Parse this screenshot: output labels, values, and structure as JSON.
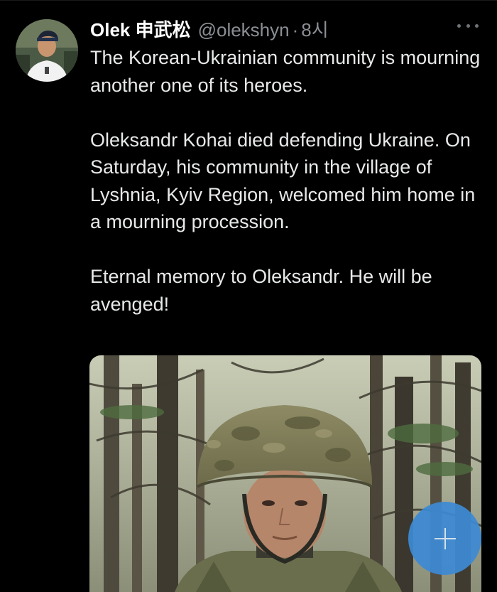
{
  "tweet": {
    "author": {
      "display_name": "Olek 申武松",
      "handle": "@olekshyn",
      "separator": "·",
      "time": "8시",
      "avatar_icon": "profile-photo"
    },
    "more_icon": "more-horizontal-icon",
    "paragraphs": [
      "The Korean-Ukrainian community is mourning another one of its heroes.",
      "Oleksandr Kohai died defending Ukraine. On Saturday, his community in the village of Lyshnia, Kyiv Region, welcomed him home in a mourning procession.",
      "Eternal memory to Oleksandr. He will be avenged!"
    ],
    "media": {
      "kind": "photo"
    }
  },
  "compose_fab": {
    "icon": "plus-icon",
    "color": "#3d8ad4"
  }
}
